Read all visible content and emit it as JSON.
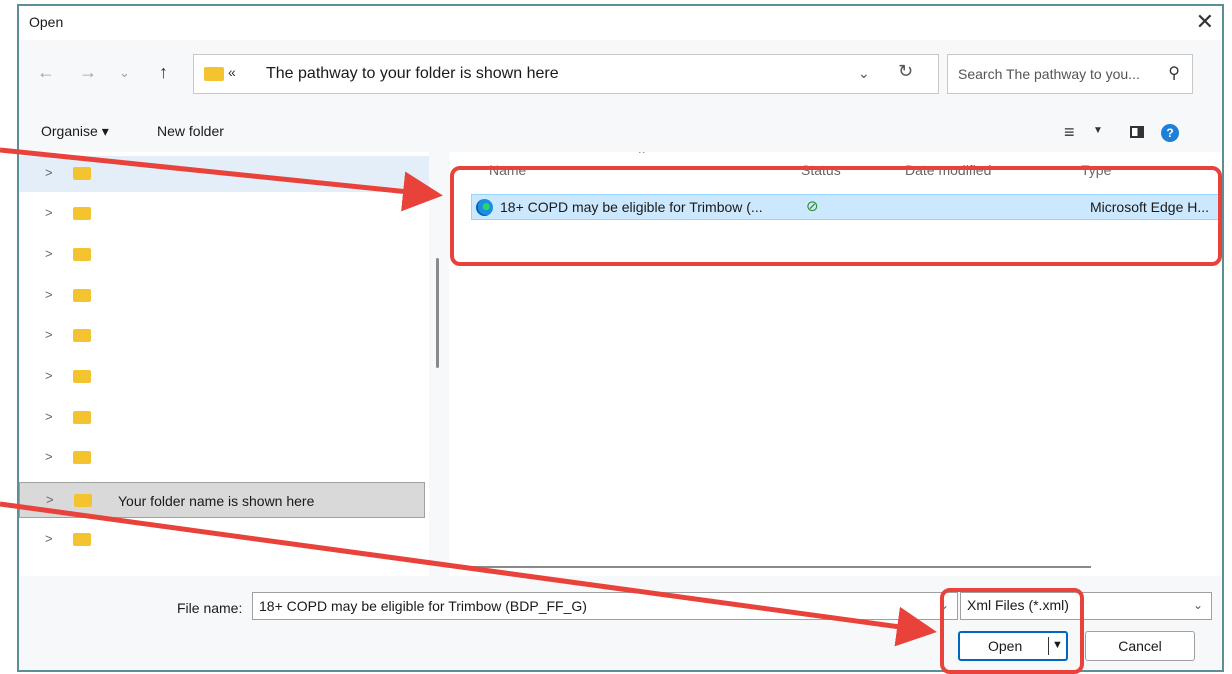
{
  "window": {
    "title": "Open"
  },
  "address_bar": {
    "chevrons": "«",
    "path_text": "The pathway to your folder is shown here"
  },
  "search": {
    "placeholder": "Search The pathway to you..."
  },
  "toolbar": {
    "organise_label": "Organise ▾",
    "new_folder_label": "New folder"
  },
  "nav_pane": {
    "selected_folder_label": "Your folder name is shown here",
    "folder_count": 10
  },
  "columns": {
    "name": "Name",
    "status": "Status",
    "date_modified": "Date modified",
    "type": "Type"
  },
  "files": [
    {
      "name": "18+ COPD may be eligible for Trimbow (...",
      "status_icon": "check-circle-icon",
      "type": "Microsoft Edge H..."
    }
  ],
  "footer": {
    "file_name_label": "File name:",
    "file_name_value": "18+ COPD may be eligible for Trimbow (BDP_FF_G)",
    "file_type_value": "Xml Files (*.xml)",
    "open_label": "Open",
    "cancel_label": "Cancel"
  },
  "annotation_color": "#e8423a"
}
